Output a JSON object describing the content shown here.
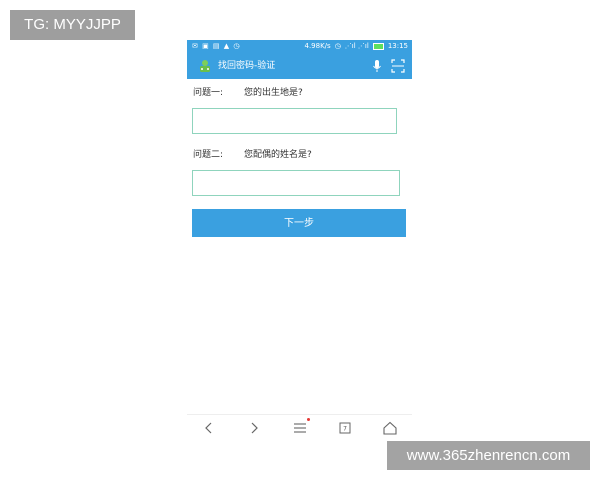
{
  "overlays": {
    "tg_label": "TG: MYYJJPP",
    "site_watermark": "www.365zhenrencn.com"
  },
  "status_bar": {
    "speed": "4.98K/s",
    "time": "13:15",
    "left_icons": [
      "notification-icons"
    ],
    "battery_color": "#5ee05e"
  },
  "header": {
    "title": "找回密码-验证",
    "icons": [
      "mic-icon",
      "scan-icon"
    ],
    "color": "#3aa0e0"
  },
  "form": {
    "q1_label": "问题一:",
    "q1_text": "您的出生地是?",
    "q1_value": "",
    "q2_label": "问题二:",
    "q2_text": "您配偶的姓名是?",
    "q2_value": "",
    "submit_label": "下一步"
  },
  "bottom_nav": {
    "tab_count": "7",
    "items": [
      "back",
      "forward",
      "menu",
      "tabs",
      "home"
    ]
  }
}
